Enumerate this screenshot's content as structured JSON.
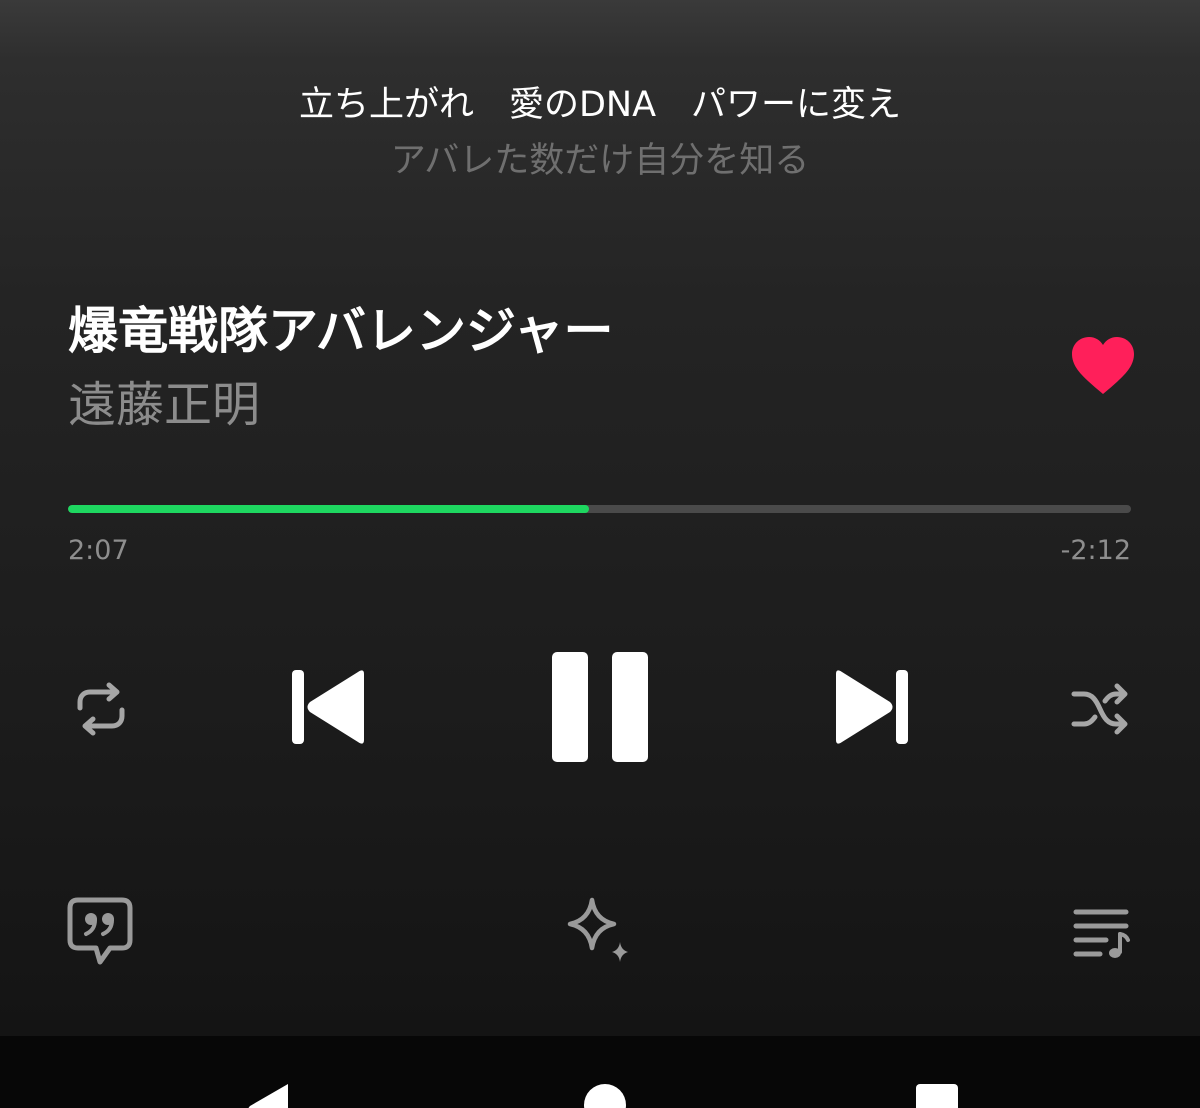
{
  "lyrics": {
    "current_line": "立ち上がれ　愛のDNA　パワーに変え",
    "next_line": "アバレた数だけ自分を知る"
  },
  "track": {
    "title": "爆竜戦隊アバレンジャー",
    "artist": "遠藤正明",
    "liked": true
  },
  "playback": {
    "elapsed": "2:07",
    "remaining": "-2:12",
    "progress_fraction": 0.49,
    "state": "playing"
  },
  "icons": {
    "like": "heart-icon",
    "repeat": "repeat-icon",
    "previous": "skip-previous-icon",
    "pause": "pause-icon",
    "next": "skip-next-icon",
    "shuffle": "shuffle-icon",
    "lyrics": "lyrics-quote-icon",
    "ai": "sparkle-icon",
    "queue": "queue-music-icon",
    "nav_back": "back-triangle-icon",
    "nav_home": "home-circle-icon",
    "nav_recents": "recents-square-icon"
  },
  "colors": {
    "accent_progress": "#1ed760",
    "like": "#ff1f5a"
  }
}
